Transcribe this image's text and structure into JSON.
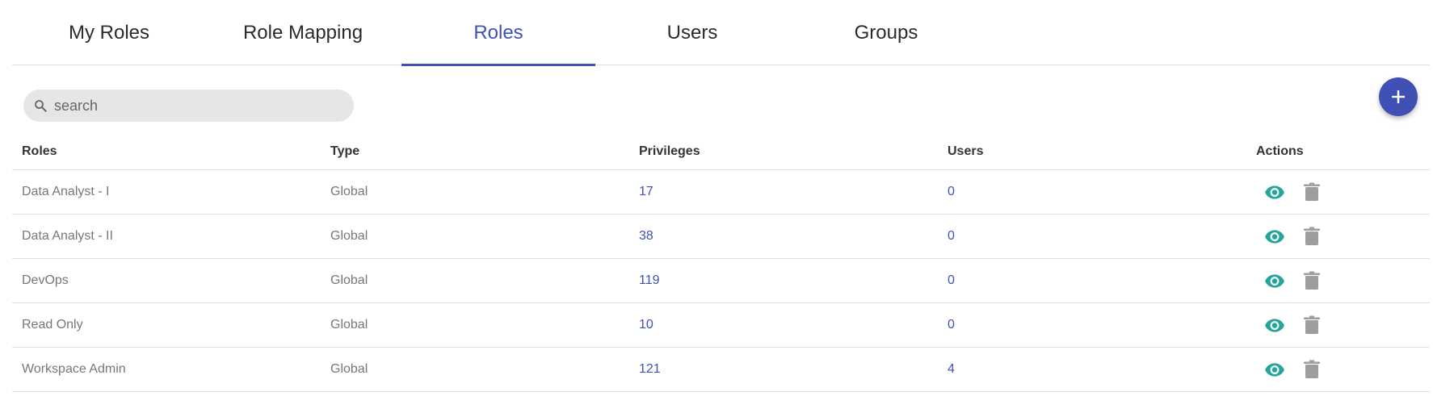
{
  "tabs": [
    {
      "label": "My Roles"
    },
    {
      "label": "Role Mapping"
    },
    {
      "label": "Roles"
    },
    {
      "label": "Users"
    },
    {
      "label": "Groups"
    }
  ],
  "active_tab": "Roles",
  "search": {
    "placeholder": "search"
  },
  "colors": {
    "accent": "#3f51b5",
    "view_icon": "#26a69a",
    "delete_icon": "#9e9e9e"
  },
  "table": {
    "headers": {
      "roles": "Roles",
      "type": "Type",
      "privileges": "Privileges",
      "users": "Users",
      "actions": "Actions"
    },
    "rows": [
      {
        "role": "Data Analyst - I",
        "type": "Global",
        "privileges": "17",
        "users": "0"
      },
      {
        "role": "Data Analyst - II",
        "type": "Global",
        "privileges": "38",
        "users": "0"
      },
      {
        "role": "DevOps",
        "type": "Global",
        "privileges": "119",
        "users": "0"
      },
      {
        "role": "Read Only",
        "type": "Global",
        "privileges": "10",
        "users": "0"
      },
      {
        "role": "Workspace Admin",
        "type": "Global",
        "privileges": "121",
        "users": "4"
      }
    ]
  },
  "icons": {
    "search": "search-icon",
    "add": "add-icon",
    "view": "eye-icon",
    "delete": "trash-icon"
  }
}
